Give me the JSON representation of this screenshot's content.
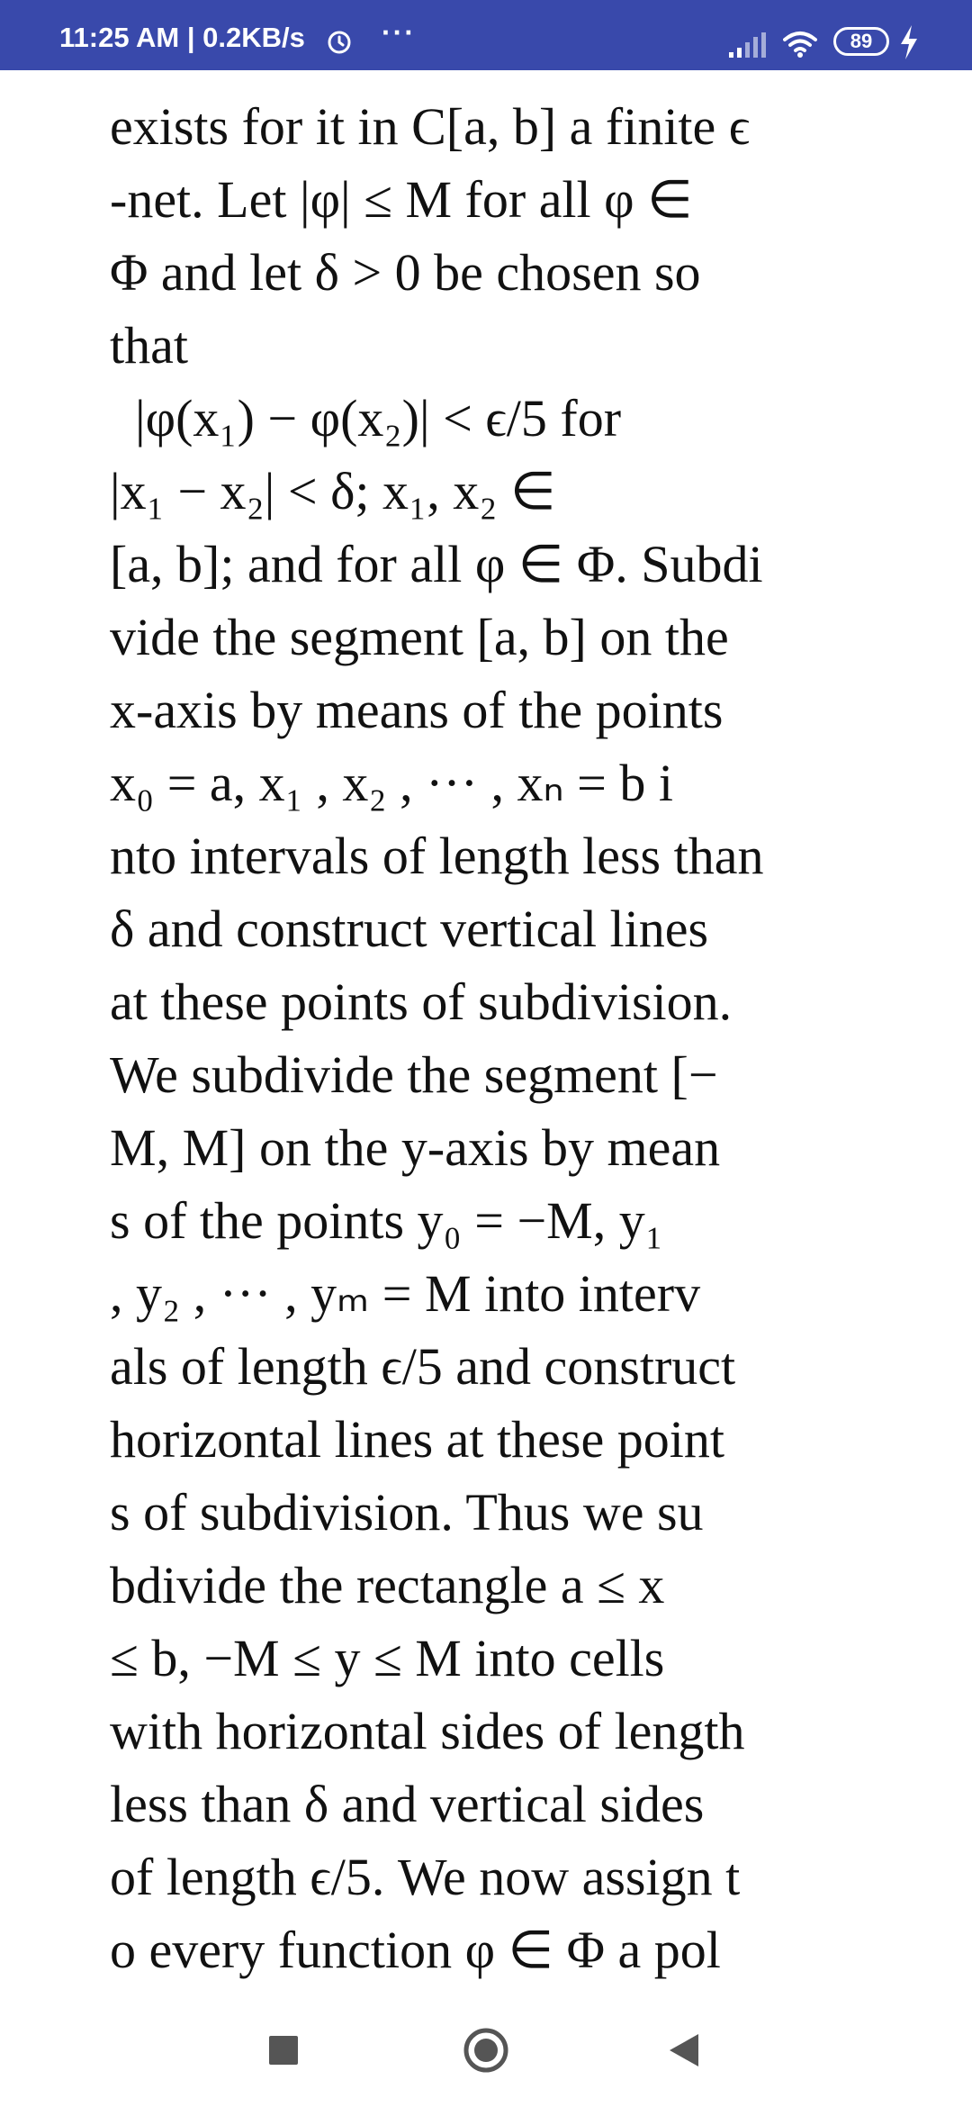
{
  "status_bar": {
    "time_speed": "11:25 AM | 0.2KB/s",
    "more": "···",
    "battery": "89",
    "color": "#3949ab",
    "icons": [
      "alarm-icon",
      "more-icon",
      "signal-icon",
      "wifi-icon",
      "battery-icon",
      "charging-icon"
    ]
  },
  "page": {
    "lines": [
      "exists for it in C[a, b] a finite ϵ",
      "-net. Let |φ| ≤ M for all φ ∈",
      "Φ and let δ > 0 be chosen so",
      "that",
      "|φ(x₁) − φ(x₂)| < ϵ/5  for",
      "|x₁ − x₂| < δ;  x₁, x₂ ∈",
      "[a, b]; and for all φ ∈ Φ. Subdi",
      "vide the segment [a, b] on the",
      "x-axis by means of the points",
      "x₀ = a, x₁ , x₂ , ··· , xₙ = b i",
      "nto intervals of length less than",
      "δ and construct vertical lines",
      "at these points of subdivision.",
      "We subdivide the segment [−",
      "M, M] on the y-axis by mean",
      "s of the points y₀ = −M, y₁",
      ", y₂ , ··· , yₘ = M into interv",
      "als of length ϵ/5 and construct",
      "horizontal lines at these point",
      "s of subdivision. Thus we su",
      "bdivide the rectangle a ≤ x",
      "≤ b, −M ≤ y ≤ M into cells",
      "with horizontal sides of length",
      "less than δ and vertical sides",
      "of length ϵ/5. We now assign t",
      "o every function φ ∈ Φ a pol"
    ]
  },
  "nav_bar": {
    "icons": [
      "recents-icon",
      "home-icon",
      "back-icon"
    ]
  }
}
